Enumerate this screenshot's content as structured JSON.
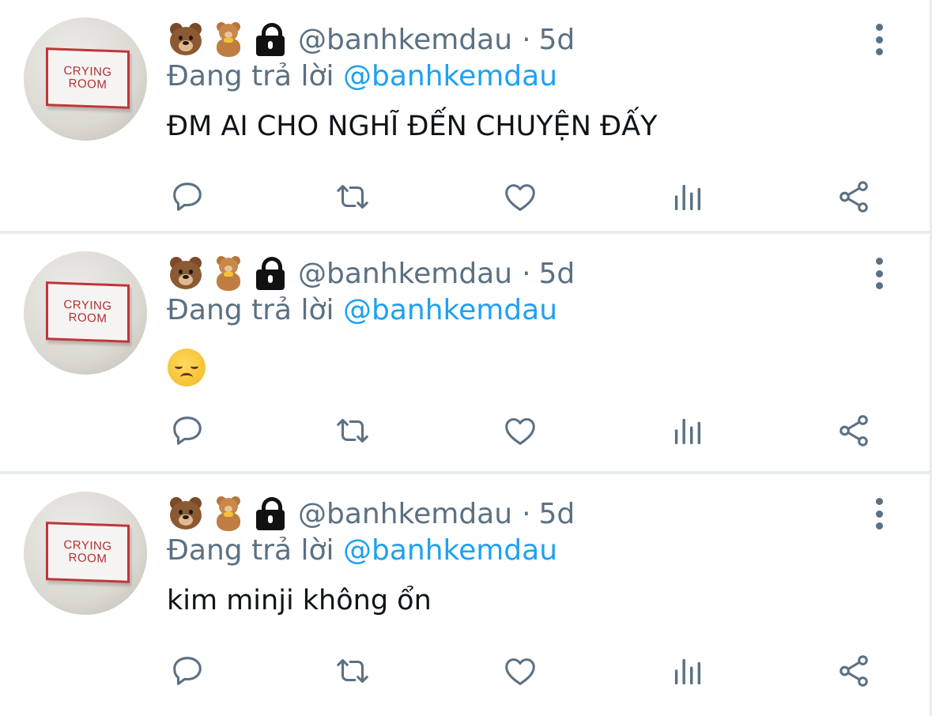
{
  "tweets": [
    {
      "avatar": {
        "line1": "CRYING",
        "line2": "ROOM"
      },
      "header": {
        "handle": "@banhkemdau",
        "separator": "·",
        "time": "5d"
      },
      "replying": {
        "prefix": "Đang trả lời",
        "mention": "@banhkemdau"
      },
      "text": "ĐM AI CHO NGHĨ ĐẾN CHUYỆN ĐẤY"
    },
    {
      "avatar": {
        "line1": "CRYING",
        "line2": "ROOM"
      },
      "header": {
        "handle": "@banhkemdau",
        "separator": "·",
        "time": "5d"
      },
      "replying": {
        "prefix": "Đang trả lời",
        "mention": "@banhkemdau"
      },
      "text": ""
    },
    {
      "avatar": {
        "line1": "CRYING",
        "line2": "ROOM"
      },
      "header": {
        "handle": "@banhkemdau",
        "separator": "·",
        "time": "5d"
      },
      "replying": {
        "prefix": "Đang trả lời",
        "mention": "@banhkemdau"
      },
      "text": "kim minji không ổn"
    }
  ],
  "icons": {
    "name_emojis": [
      "bear-face-icon",
      "teddy-bear-icon"
    ],
    "protected": "lock-icon",
    "tweet2_emoji": "disappointed-face-icon",
    "menu": "more-vertical-icon",
    "actions": [
      "reply-icon",
      "retweet-icon",
      "like-icon",
      "analytics-icon",
      "share-icon"
    ]
  },
  "colors": {
    "secondary_text": "#5b7083",
    "mention": "#1da1f2",
    "primary_text": "#0f1419",
    "divider": "#e7ebee",
    "avatar_sign_border": "#c0353a"
  }
}
